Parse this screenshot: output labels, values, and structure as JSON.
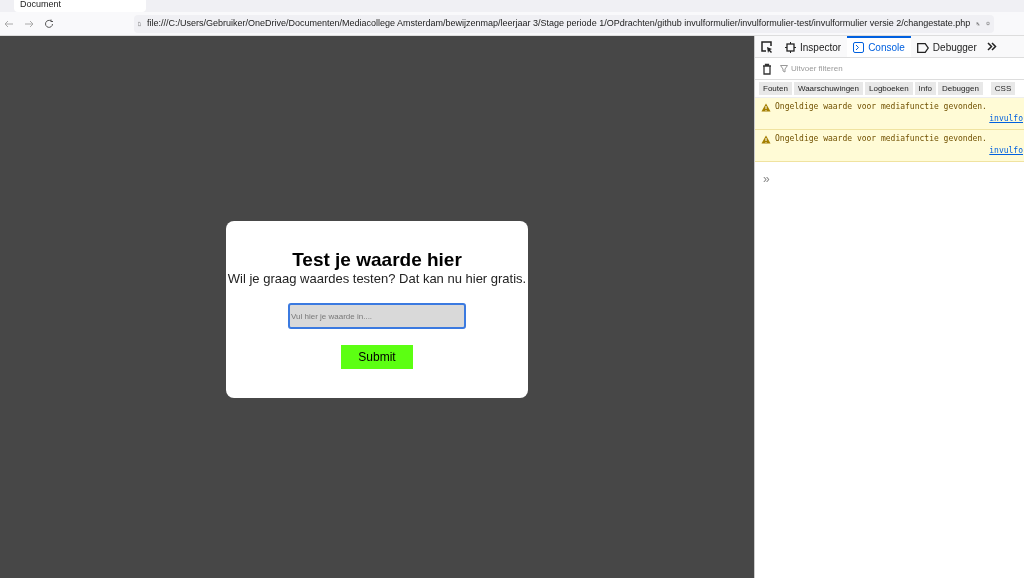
{
  "browser": {
    "tab_title": "Document",
    "address": "file:///C:/Users/Gebruiker/OneDrive/Documenten/Mediacollege Amsterdam/bewijzenmap/leerjaar 3/Stage periode 1/OPdrachten/github invulformulier/invulformulier-test/invulformulier versie 2/changestate.php"
  },
  "page": {
    "title": "Test je waarde hier",
    "subtitle": "Wil je graag waardes testen? Dat kan nu hier gratis.",
    "input": {
      "placeholder": "Vul hier je waarde in...."
    },
    "button": "Submit"
  },
  "devtools": {
    "tabs": [
      {
        "label": "Inspector",
        "selected": false
      },
      {
        "label": "Console",
        "selected": true
      },
      {
        "label": "Debugger",
        "selected": false
      }
    ],
    "filter": {
      "placeholder": "Uitvoer filteren"
    },
    "filters": [
      "Fouten",
      "Waarschuwingen",
      "Logboeken",
      "Info",
      "Debuggen",
      "CSS"
    ],
    "messages": [
      {
        "text": "Ongeldige waarde voor mediafunctie gevonden.",
        "source": "invulfo"
      },
      {
        "text": "Ongeldige waarde voor mediafunctie gevonden.",
        "source": "invulfo"
      }
    ],
    "prompt": "»"
  }
}
